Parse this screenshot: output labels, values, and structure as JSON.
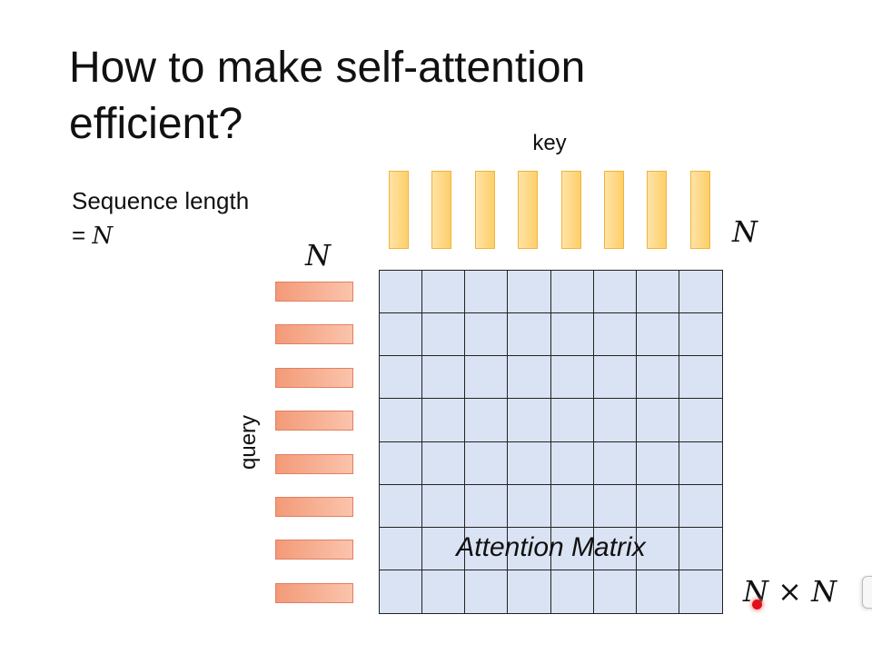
{
  "slide": {
    "title": "How to make self-attention efficient?",
    "sequence_text": "Sequence length",
    "sequence_eq": "= ",
    "sequence_var": "N"
  },
  "diagram": {
    "key_label": "key",
    "query_label": "query",
    "key_count_label": "N",
    "query_count_label": "N",
    "matrix_label": "Attention Matrix",
    "matrix_size_label": "N × N",
    "grid_rows": 8,
    "grid_cols": 8,
    "key_tokens": 8,
    "query_tokens": 8
  },
  "colors": {
    "key_bar": "#fdcf6a",
    "query_bar": "#f39a78",
    "matrix_fill": "#dae3f3",
    "grid_line": "#222222",
    "pointer": "#e0101a"
  }
}
